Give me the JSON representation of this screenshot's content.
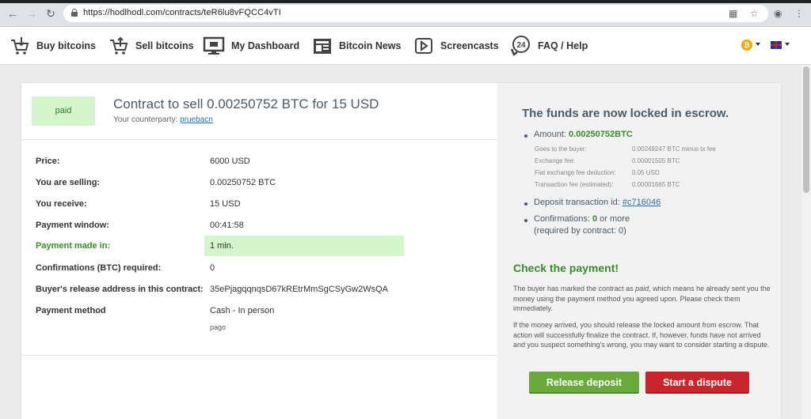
{
  "browser": {
    "url": "https://hodlhodl.com/contracts/teR6lu8vFQCC4vTI",
    "back_icon": "arrow-left-icon",
    "forward_icon": "arrow-right-icon",
    "reload_icon": "reload-icon"
  },
  "nav": {
    "items": [
      {
        "label": "Buy bitcoins",
        "icon": "cart-download-icon"
      },
      {
        "label": "Sell bitcoins",
        "icon": "cart-upload-icon"
      },
      {
        "label": "My Dashboard",
        "icon": "monitor-icon"
      },
      {
        "label": "Bitcoin News",
        "icon": "newspaper-icon"
      },
      {
        "label": "Screencasts",
        "icon": "play-icon"
      },
      {
        "label": "FAQ / Help",
        "icon": "support-24-icon"
      }
    ],
    "currency_symbol": "₿"
  },
  "contract": {
    "status": "paid",
    "title": "Contract to sell 0.00250752 BTC for 15 USD",
    "counterparty_label": "Your counterparty:",
    "counterparty": "pruebacn",
    "details": [
      {
        "label": "Price:",
        "value": "6000 USD"
      },
      {
        "label": "You are selling:",
        "value": "0.00250752 BTC"
      },
      {
        "label": "You receive:",
        "value": "15 USD"
      },
      {
        "label": "Payment window:",
        "value": "00:41:58"
      },
      {
        "label": "Payment made in:",
        "value": "1 min."
      },
      {
        "label": "Confirmations (BTC) required:",
        "value": "0"
      },
      {
        "label": "Buyer's release address in this contract:",
        "value": "35ePjagqqnqsD67kREtrMmSgCSyGw2WsQA"
      },
      {
        "label": "Payment method",
        "value": "Cash - In person"
      }
    ],
    "payment_method_note": "pago"
  },
  "escrow": {
    "title": "The funds are now locked in escrow.",
    "amount_label": "Amount:",
    "amount": "0.00250752BTC",
    "fees": [
      {
        "label": "Goes to the buyer:",
        "value": "0.00249247 BTC minus tx fee"
      },
      {
        "label": "Exchange fee:",
        "value": "0.00001505 BTC"
      },
      {
        "label": "Fiat exchange fee deduction:",
        "value": "0.05 USD"
      },
      {
        "label": "Transaction fee (estimated):",
        "value": "0.00001665 BTC"
      }
    ],
    "deposit_label": "Deposit transaction id:",
    "deposit_id": "#c716046",
    "confirmations_label": "Confirmations:",
    "confirmations_value": "0",
    "confirmations_suffix": "or more",
    "required_text": "(required by contract: 0)"
  },
  "check": {
    "title": "Check the payment!",
    "para1_a": "The buyer has marked the contract as ",
    "para1_em": "paid",
    "para1_b": ", which means he already sent you the money using the payment method you agreed upon. Please check them immediately.",
    "para2": "If the money arrived, you should release the locked amount from escrow. That action will successfully finalize the contract. If, however, funds have not arrived and you suspect something's wrong, you may want to consider starting a dispute.",
    "release_button": "Release deposit",
    "dispute_button": "Start a dispute"
  }
}
